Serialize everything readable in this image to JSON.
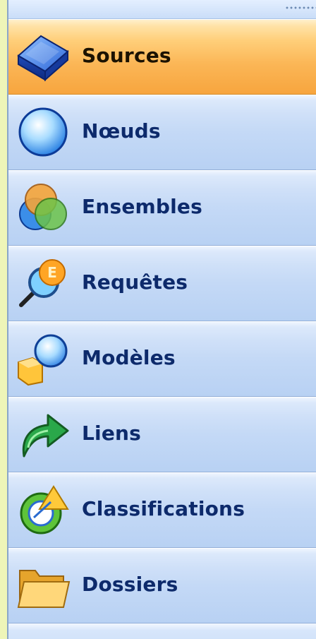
{
  "nav": {
    "selected_index": 0,
    "items": [
      {
        "label": "Sources",
        "icon": "source-cube-icon",
        "selected": true
      },
      {
        "label": "Nœuds",
        "icon": "node-sphere-icon",
        "selected": false
      },
      {
        "label": "Ensembles",
        "icon": "sets-circles-icon",
        "selected": false
      },
      {
        "label": "Requêtes",
        "icon": "query-magnifier-icon",
        "selected": false
      },
      {
        "label": "Modèles",
        "icon": "model-shapes-icon",
        "selected": false
      },
      {
        "label": "Liens",
        "icon": "link-arrow-icon",
        "selected": false
      },
      {
        "label": "Classifications",
        "icon": "classification-icon",
        "selected": false
      },
      {
        "label": "Dossiers",
        "icon": "folder-icon",
        "selected": false
      }
    ]
  },
  "colors": {
    "selected_bg": "#f7a53e",
    "item_bg": "#c4d9f6",
    "label_text": "#0d2a6b",
    "outer_bg": "#eef5b8"
  }
}
